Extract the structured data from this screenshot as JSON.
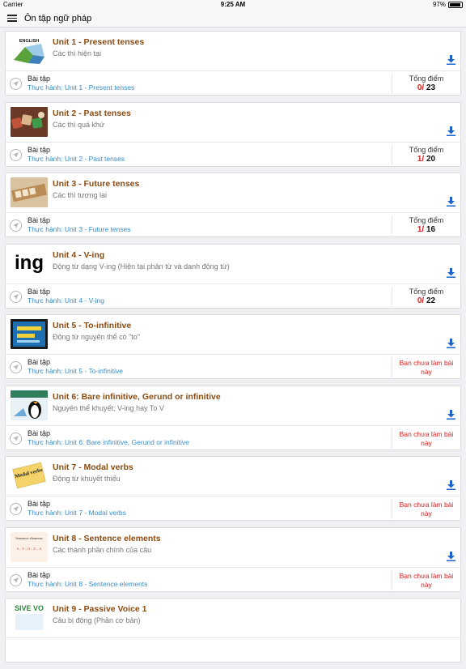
{
  "status_bar": {
    "carrier": "Carrier",
    "time": "9:25 AM",
    "battery": "97%"
  },
  "nav": {
    "title": "Ôn tập ngữ pháp"
  },
  "common": {
    "exercise_label": "Bài tập",
    "total_label": "Tổng điểm",
    "not_done": "Bạn chưa làm bài này"
  },
  "units": [
    {
      "title": "Unit 1 -  Present tenses",
      "subtitle": "Các thì hiện tại",
      "link": "Thực hành: Unit 1 -  Present tenses",
      "score": "0/",
      "total": " 23",
      "thumb": "ENGLISH"
    },
    {
      "title": "Unit 2 - Past tenses",
      "subtitle": "Các thì quá khứ",
      "link": "Thực hành: Unit 2 - Past tenses",
      "score": "1/",
      "total": " 20"
    },
    {
      "title": "Unit 3 - Future tenses",
      "subtitle": "Các thì tương lai",
      "link": "Thực hành: Unit 3 - Future tenses",
      "score": "1/",
      "total": " 16"
    },
    {
      "title": "Unit 4 - V-ing",
      "subtitle": "Động từ dạng V-ing (Hiện tại phân từ và danh động từ)",
      "link": "Thực hành: Unit 4 - V-ing",
      "score": "0/",
      "total": " 22",
      "thumb": "ing"
    },
    {
      "title": "Unit 5 - To-infinitive",
      "subtitle": "Động từ nguyên thể có \"to\"",
      "link": "Thực hành: Unit 5 - To-infinitive"
    },
    {
      "title": "Unit 6: Bare infinitive, Gerund or infinitive",
      "subtitle": "Nguyên thể khuyết; V-ing hay To V",
      "link": "Thực hành: Unit 6: Bare infinitive, Gerund or infinitive"
    },
    {
      "title": "Unit 7 - Modal verbs",
      "subtitle": "Động từ khuyết thiếu",
      "link": "Thực hành: Unit 7 - Modal verbs",
      "thumb": "Modal verbs"
    },
    {
      "title": "Unit 8 - Sentence elements",
      "subtitle": "Các thành phần chính của câu",
      "link": "Thực hành: Unit 8 - Sentence elements",
      "thumb": "Sentence elements",
      "thumb2": "S – V – O – C – A"
    },
    {
      "title": "Unit 9 - Passive Voice 1",
      "subtitle": "Câu bị động (Phần cơ bản)",
      "thumb": "SIVE VO"
    }
  ],
  "colors": {
    "unit_title": "#8b4a0e",
    "link": "#3a8cc6",
    "score_red": "#e02020",
    "download_blue": "#1d63c9"
  }
}
